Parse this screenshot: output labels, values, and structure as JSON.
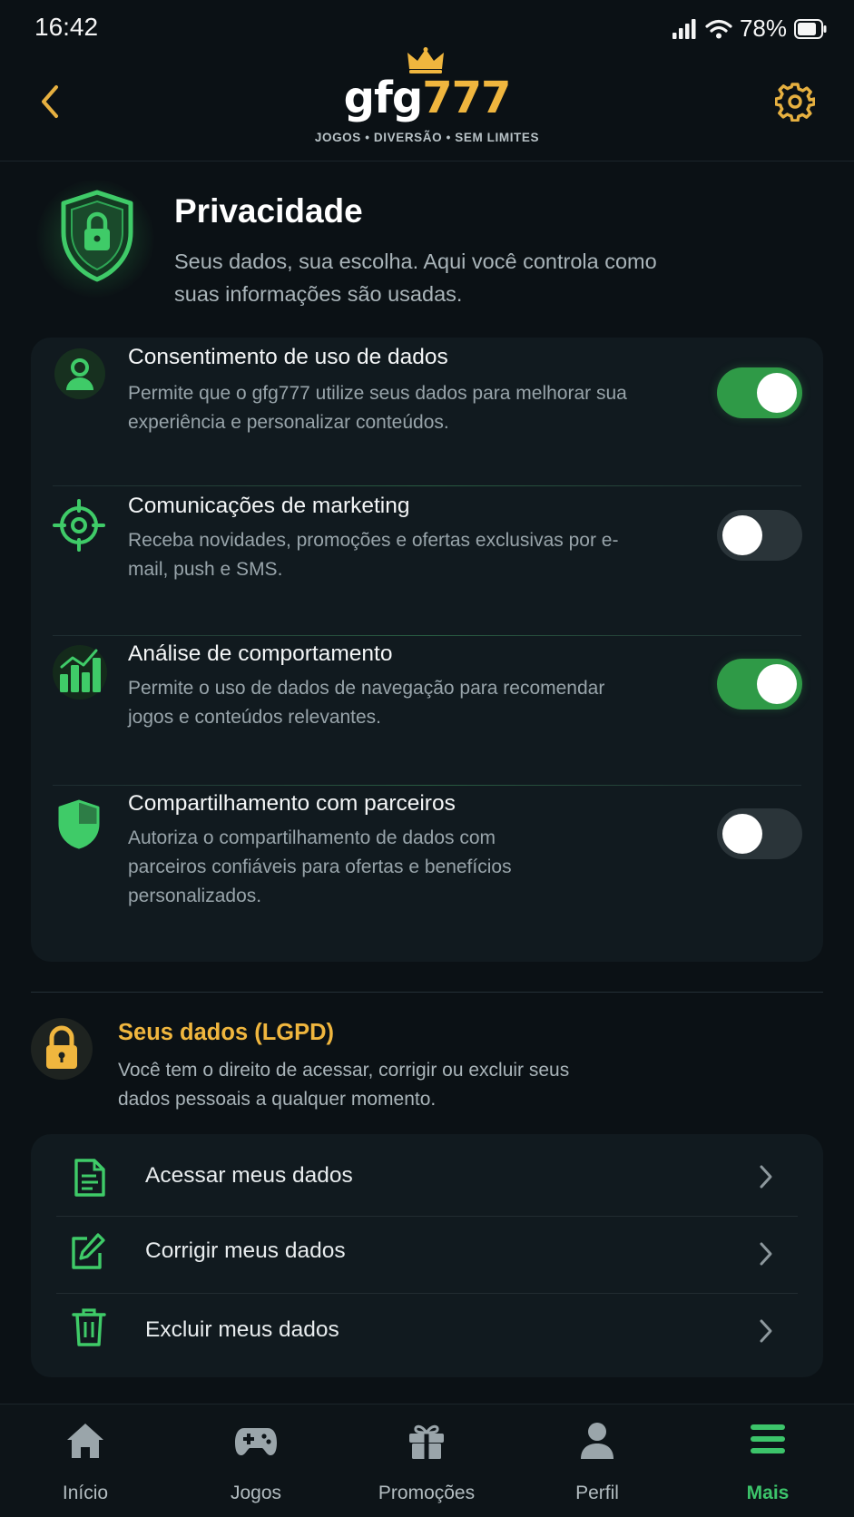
{
  "status_bar": {
    "time": "16:42",
    "battery": "78%"
  },
  "header": {
    "logo_white": "gfg",
    "logo_gold": "777",
    "tagline": "JOGOS • DIVERSÃO • SEM LIMITES",
    "back_icon": "chevron-left-icon",
    "settings_icon": "gear-icon"
  },
  "hero": {
    "title": "Privacidade",
    "subtitle": "Seus dados, sua escolha. Aqui você controla como suas informações são usadas."
  },
  "settings": [
    {
      "title": "Consentimento de uso de dados",
      "description": "Permite que o gfg777 utilize seus dados para melhorar sua experiência e personalizar conteúdos.",
      "enabled": true,
      "icon": "user-icon"
    },
    {
      "title": "Comunicações de marketing",
      "description": "Receba novidades, promoções e ofertas exclusivas por e-mail, push e SMS.",
      "enabled": false,
      "icon": "target-icon"
    },
    {
      "title": "Análise de comportamento",
      "description": "Permite o uso de dados de navegação para recomendar jogos e conteúdos relevantes.",
      "enabled": true,
      "icon": "bar-chart-icon"
    },
    {
      "title": "Compartilhamento com parceiros",
      "description": "Autoriza o compartilhamento de dados com parceiros confiáveis para ofertas e benefícios personalizados.",
      "enabled": false,
      "icon": "shield-half-icon"
    }
  ],
  "lgpd": {
    "title": "Seus dados (LGPD)",
    "subtitle": "Você tem o direito de acessar, corrigir ou excluir seus dados pessoais a qualquer momento."
  },
  "actions": [
    {
      "label": "Acessar meus dados",
      "icon": "document-icon"
    },
    {
      "label": "Corrigir meus dados",
      "icon": "edit-icon"
    },
    {
      "label": "Excluir meus dados",
      "icon": "trash-icon"
    }
  ],
  "nav": [
    {
      "label": "Início",
      "icon": "home-icon",
      "active": false
    },
    {
      "label": "Jogos",
      "icon": "gamepad-icon",
      "active": false
    },
    {
      "label": "Promoções",
      "icon": "gift-icon",
      "active": false
    },
    {
      "label": "Perfil",
      "icon": "person-icon",
      "active": false
    },
    {
      "label": "Mais",
      "icon": "menu-icon",
      "active": true
    }
  ],
  "colors": {
    "accent_green": "#3cc46a",
    "accent_gold": "#f0b63e",
    "background": "#0b1115",
    "card": "#111a1f"
  }
}
